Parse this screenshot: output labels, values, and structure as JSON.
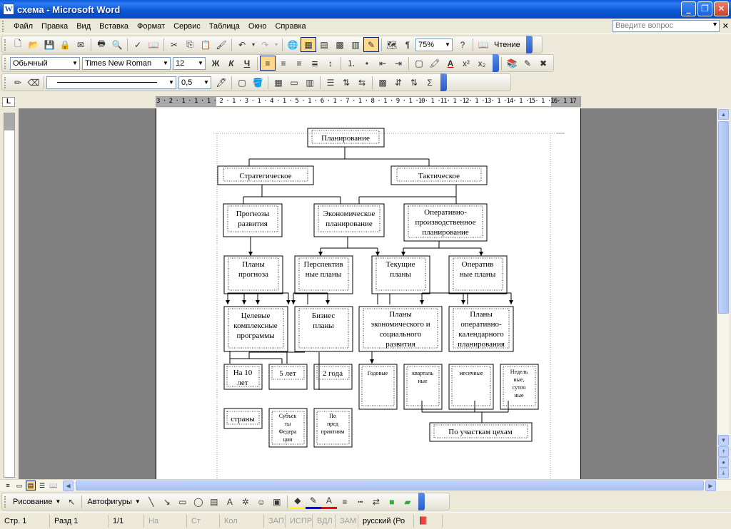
{
  "window": {
    "title": "схема - Microsoft Word"
  },
  "menu": [
    "Файл",
    "Правка",
    "Вид",
    "Вставка",
    "Формат",
    "Сервис",
    "Таблица",
    "Окно",
    "Справка"
  ],
  "help_box": {
    "placeholder": "Введите вопрос"
  },
  "standard_toolbar": {
    "zoom": "75%",
    "read_label": "Чтение"
  },
  "format_toolbar": {
    "style": "Обычный",
    "font": "Times New Roman",
    "size": "12"
  },
  "tables_toolbar": {
    "line_weight": "0,5"
  },
  "ruler": {
    "numbers": "3 · 2 · 1 · 1 · 1 · 2 · 1 · 3 · 1 · 4 · 1 · 5 · 1 · 6 · 1 · 7 · 1 · 8 · 1 · 9 · 1 ·10· 1 ·11· 1 ·12· 1 ·13· 1 ·14· 1 ·15· 1 ·16· 1 17"
  },
  "drawing_toolbar": {
    "draw_label": "Рисование",
    "autoshapes_label": "Автофигуры"
  },
  "status": {
    "page": "Стр. 1",
    "section": "Разд 1",
    "pages": "1/1",
    "at": "На",
    "line": "Ст",
    "col": "Кол",
    "rec": "ЗАП",
    "trk": "ИСПР",
    "ext": "ВДЛ",
    "ovr": "ЗАМ",
    "lang": "русский (Ро"
  },
  "diagram": {
    "root": "Планирование",
    "strategic": "Стратегическое",
    "tactical": "Тактическое",
    "forecasts": [
      "Прогнозы",
      "развития"
    ],
    "economic": [
      "Экономическое",
      "планирование"
    ],
    "operational": [
      "Оперативно-",
      "производственное",
      "планирование"
    ],
    "forecast_plans": [
      "Планы",
      "прогноза"
    ],
    "perspective": [
      "Перспектив",
      "ные планы"
    ],
    "current": [
      "Текущие",
      "планы"
    ],
    "operative_plans": [
      "Оператив",
      "ные планы"
    ],
    "target_programs": [
      "Целевые",
      "комплексные",
      "программы"
    ],
    "business_plans": [
      "Бизнес",
      "планы"
    ],
    "econ_social": [
      "Планы",
      "экономического и",
      "социального",
      "развития"
    ],
    "calendar": [
      "Планы",
      "оперативно-",
      "календарного",
      "планирования"
    ],
    "ten_years": [
      "На 10",
      "лет"
    ],
    "five_years": "5 лет",
    "two_years": "2 года",
    "annual": "Годовые",
    "quarterly": [
      "кварталь",
      "ные"
    ],
    "monthly": "месячные",
    "weekly": [
      "Недель",
      "ные,",
      "суточ",
      "ные"
    ],
    "countries": "страны",
    "subjects": [
      "Субъек",
      "ты",
      "Федера",
      "ции"
    ],
    "enterprises": [
      "По",
      "пред",
      "приятиям"
    ],
    "workshops": "По участкам цехам"
  }
}
